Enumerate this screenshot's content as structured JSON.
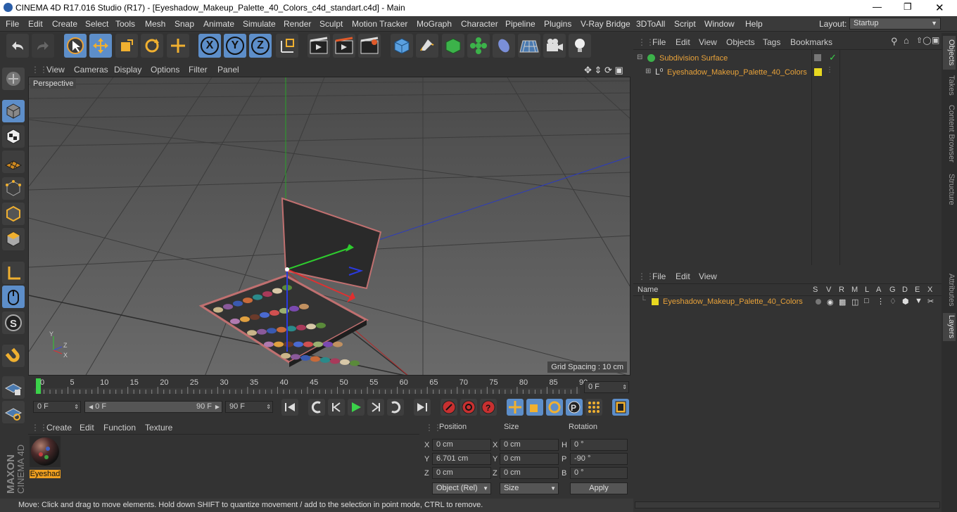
{
  "window": {
    "title": "CINEMA 4D R17.016 Studio (R17) - [Eyeshadow_Makeup_Palette_40_Colors_c4d_standart.c4d] - Main"
  },
  "menu": [
    "File",
    "Edit",
    "Create",
    "Select",
    "Tools",
    "Mesh",
    "Snap",
    "Animate",
    "Simulate",
    "Render",
    "Sculpt",
    "Motion Tracker",
    "MoGraph",
    "Character",
    "Pipeline",
    "Plugins",
    "V-Ray Bridge",
    "3DToAll",
    "Script",
    "Window",
    "Help"
  ],
  "layout": {
    "label": "Layout:",
    "value": "Startup"
  },
  "viewport": {
    "menu": [
      "View",
      "Cameras",
      "Display",
      "Options",
      "Filter",
      "Panel"
    ],
    "label": "Perspective",
    "grid_spacing": "Grid Spacing : 10 cm"
  },
  "timeline": {
    "ticks": [
      "0",
      "5",
      "10",
      "15",
      "20",
      "25",
      "30",
      "35",
      "40",
      "45",
      "50",
      "55",
      "60",
      "65",
      "70",
      "75",
      "80",
      "85",
      "90"
    ],
    "current_frame": "0 F"
  },
  "transport": {
    "start": "0 F",
    "range_start": "0 F",
    "range_end": "90 F",
    "end": "90 F"
  },
  "materials": {
    "menu": [
      "Create",
      "Edit",
      "Function",
      "Texture"
    ],
    "items": [
      {
        "name": "Eyeshad"
      }
    ]
  },
  "coords": {
    "headers": [
      "Position",
      "Size",
      "Rotation"
    ],
    "rows": [
      {
        "axis": "X",
        "pos": "0 cm",
        "saxis": "X",
        "size": "0 cm",
        "raxis": "H",
        "rot": "0 °"
      },
      {
        "axis": "Y",
        "pos": "6.701 cm",
        "saxis": "Y",
        "size": "0 cm",
        "raxis": "P",
        "rot": "-90 °"
      },
      {
        "axis": "Z",
        "pos": "0 cm",
        "saxis": "Z",
        "size": "0 cm",
        "raxis": "B",
        "rot": "0 °"
      }
    ],
    "mode": "Object (Rel)",
    "size_mode": "Size",
    "apply": "Apply"
  },
  "status": "Move: Click and drag to move elements. Hold down SHIFT to quantize movement / add to the selection in point mode, CTRL to remove.",
  "objects": {
    "menu": [
      "File",
      "Edit",
      "View",
      "Objects",
      "Tags",
      "Bookmarks"
    ],
    "tree": [
      {
        "name": "Subdivision Surface"
      },
      {
        "name": "Eyeshadow_Makeup_Palette_40_Colors"
      }
    ]
  },
  "layers": {
    "menu": [
      "File",
      "Edit",
      "View"
    ],
    "name_header": "Name",
    "flags": [
      "S",
      "V",
      "R",
      "M",
      "L",
      "A",
      "G",
      "D",
      "E",
      "X"
    ],
    "items": [
      {
        "name": "Eyeshadow_Makeup_Palette_40_Colors"
      }
    ]
  },
  "side_tabs": [
    "Objects",
    "Takes",
    "Content Browser",
    "Structure",
    "Attributes",
    "Layers"
  ],
  "colors": {
    "accent": "#e8a23a",
    "active_blue": "#5d8ec9",
    "bg": "#333333"
  }
}
